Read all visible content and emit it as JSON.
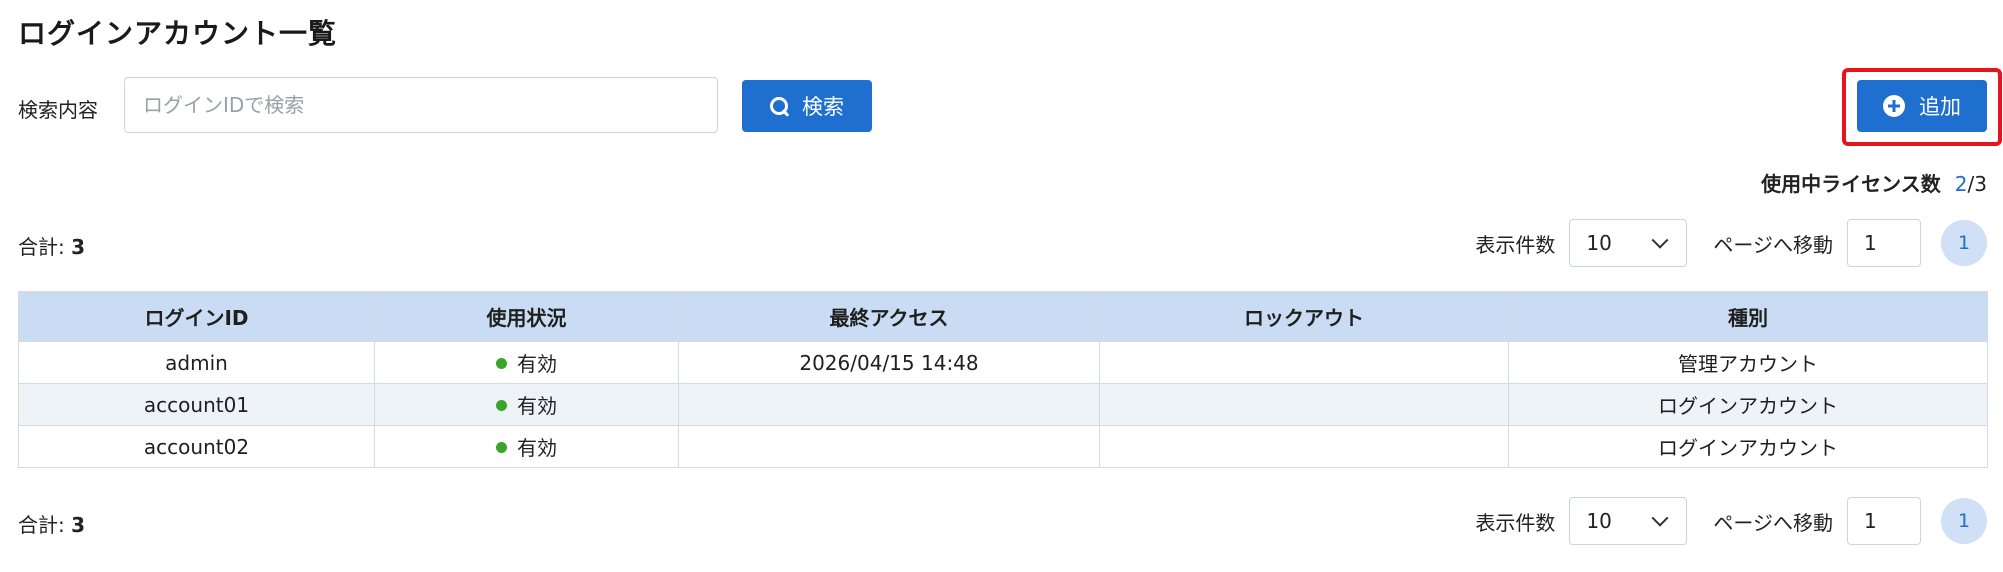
{
  "page": {
    "title": "ログインアカウント一覧"
  },
  "search": {
    "label": "検索内容",
    "placeholder": "ログインIDで検索",
    "value": "",
    "button_label": "検索"
  },
  "toolbar": {
    "add_label": "追加"
  },
  "license": {
    "label": "使用中ライセンス数",
    "used": "2",
    "separator": "/",
    "total": "3"
  },
  "pagination_top": {
    "total_label": "合計:",
    "total_value": "3",
    "per_page_label": "表示件数",
    "per_page_value": "10",
    "goto_label": "ページへ移動",
    "goto_value": "1",
    "current_page": "1"
  },
  "pagination_bottom": {
    "total_label": "合計:",
    "total_value": "3",
    "per_page_label": "表示件数",
    "per_page_value": "10",
    "goto_label": "ページへ移動",
    "goto_value": "1",
    "current_page": "1"
  },
  "table": {
    "columns": [
      "ログインID",
      "使用状況",
      "最終アクセス",
      "ロックアウト",
      "種別"
    ],
    "rows": [
      {
        "login_id": "admin",
        "status": "有効",
        "last_access": "2026/04/15 14:48",
        "lockout": "",
        "type": "管理アカウント"
      },
      {
        "login_id": "account01",
        "status": "有効",
        "last_access": "",
        "lockout": "",
        "type": "ログインアカウント"
      },
      {
        "login_id": "account02",
        "status": "有効",
        "last_access": "",
        "lockout": "",
        "type": "ログインアカウント"
      }
    ]
  },
  "colors": {
    "primary": "#1f6fd0",
    "highlight": "#e8141c",
    "header_bg": "#c9dcf3",
    "status_active": "#3aa52a"
  },
  "icons": {
    "search_button": "search-icon",
    "add_button": "plus-circle-icon",
    "select": "chevron-down-icon",
    "status": "status-dot-icon"
  }
}
